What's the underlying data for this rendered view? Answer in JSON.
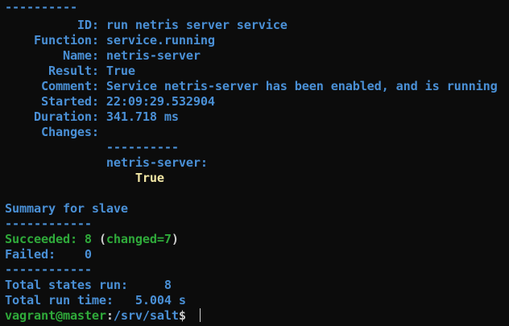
{
  "colors": {
    "background": "#0c0c0c",
    "blue": "#4a90d6",
    "green": "#2faa3a",
    "white": "#cccccc",
    "yellow": "#f2e7a5"
  },
  "state": {
    "separator": "----------",
    "id_label": "          ID:",
    "id_value": " run netris server service",
    "function_label": "    Function:",
    "function_value": " service.running",
    "name_label": "        Name:",
    "name_value": " netris-server",
    "result_label": "      Result:",
    "result_value": " True",
    "comment_label": "     Comment:",
    "comment_value": " Service netris-server has been enabled, and is running",
    "started_label": "     Started:",
    "started_value": " 22:09:29.532904",
    "duration_label": "    Duration:",
    "duration_value": " 341.718 ms",
    "changes_label": "     Changes:",
    "changes_separator": "              ----------",
    "changes_key": "              netris-server:",
    "changes_value": "                  True"
  },
  "summary": {
    "title": "Summary for slave",
    "separator_top": "------------",
    "succeeded_label": "Succeeded: 8 ",
    "paren_open": "(",
    "changed_text": "changed=7",
    "paren_close": ")",
    "failed_text": "Failed:    0",
    "separator_bottom": "------------",
    "total_states_text": "Total states run:     8",
    "total_time_text": "Total run time:   5.004 s"
  },
  "prompt": {
    "user_host": "vagrant@master",
    "colon": ":",
    "path": "/srv/salt",
    "symbol": "$ "
  }
}
